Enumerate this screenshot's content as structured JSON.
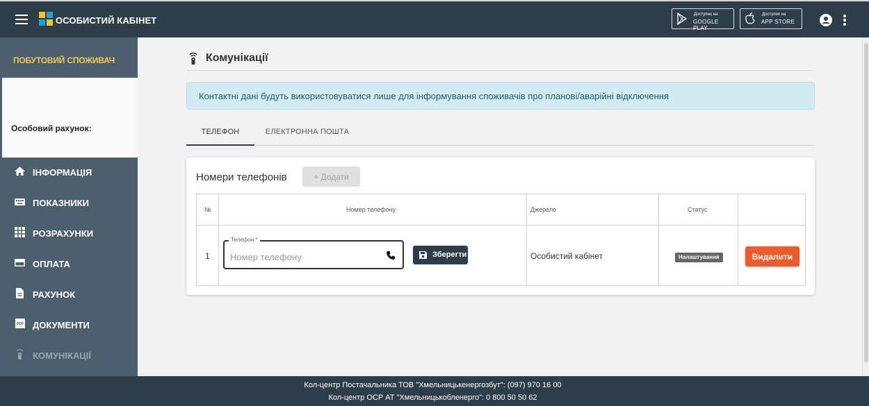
{
  "header": {
    "title": "ОСОБИСТИЙ КАБІНЕТ",
    "google_play_small": "Доступно на",
    "google_play_big": "GOOGLE PLAY",
    "app_store_small": "Доступно на",
    "app_store_big": "APP STORE",
    "colors": {
      "bar": "#2d3d4a",
      "logo_yellow": "#f5c518",
      "logo_blue": "#1aa0e6"
    }
  },
  "sidebar": {
    "consumer_type": "ПОБУТОВИЙ СПОЖИВАЧ",
    "account_label": "Особовий рахунок:",
    "items": [
      {
        "label": "ІНФОРМАЦІЯ",
        "icon": "home-icon"
      },
      {
        "label": "ПОКАЗНИКИ",
        "icon": "keyboard-icon"
      },
      {
        "label": "РОЗРАХУНКИ",
        "icon": "grid-icon"
      },
      {
        "label": "ОПЛАТА",
        "icon": "credit-card-icon"
      },
      {
        "label": "РАХУНОК",
        "icon": "document-icon"
      },
      {
        "label": "ДОКУМЕНТИ",
        "icon": "pdf-icon"
      },
      {
        "label": "КОМУНІКАЦІЇ",
        "icon": "remote-icon"
      }
    ]
  },
  "main": {
    "title": "Комунікації",
    "notice": "Контактні дані будуть використовуватися лише для інформування споживачів про планові/аварійні відключення",
    "tabs": [
      {
        "label": "ТЕЛЕФОН",
        "active": true
      },
      {
        "label": "ЕЛЕКТРОННА ПОШТА",
        "active": false
      }
    ],
    "card": {
      "title": "Номери телефонів",
      "add_label": "+ Додати",
      "columns": [
        "№",
        "Номер телефону",
        "Джерело",
        "Статус"
      ],
      "rows": [
        {
          "num": "1",
          "field_label": "Телефон *",
          "field_placeholder": "Номер телефону",
          "save_label": "Зберегти",
          "source": "Особистий кабінет",
          "status": "Налаштування",
          "delete_label": "Видалити"
        }
      ]
    }
  },
  "footer": {
    "line1": "Кол-центр Постачальника ТОВ \"Хмельницькенергозбут\": (097) 970 16 00",
    "line2": "Кол-центр ОСР АТ \"Хмельницькобленерго\": 0 800 50 50 62"
  }
}
